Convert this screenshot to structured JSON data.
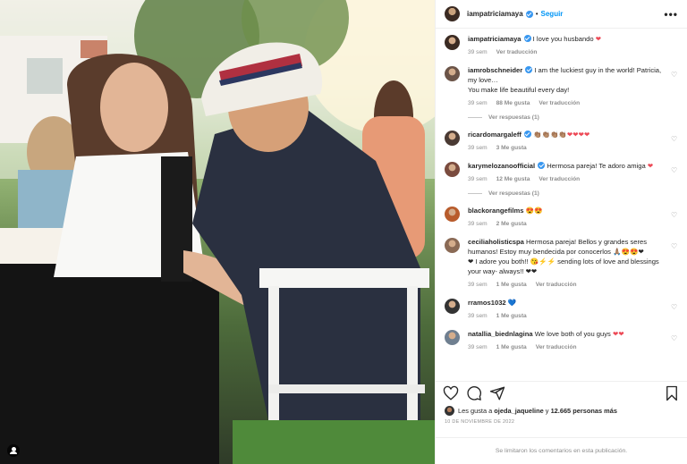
{
  "post": {
    "author": "iampatriciamaya",
    "follow_label": "Seguir",
    "more_label": "•••",
    "separator": "•"
  },
  "comments": [
    {
      "user": "iampatriciamaya",
      "verified": true,
      "text": "I love you husbando",
      "emoji": "❤",
      "time": "39 sem",
      "likes": "",
      "translate": "Ver traducción"
    },
    {
      "user": "iamrobschneider",
      "verified": true,
      "text": "I am the luckiest guy in the world! Patricia, my love…",
      "text2": "You make life beautiful every day!",
      "time": "39 sem",
      "likes": "88 Me gusta",
      "translate": "Ver traducción",
      "replies": "Ver respuestas (1)"
    },
    {
      "user": "ricardomargaleff",
      "verified": true,
      "text": "",
      "emoji": "👏🏽👏🏽👏🏽👏🏽❤❤❤❤",
      "time": "39 sem",
      "likes": "3 Me gusta",
      "translate": ""
    },
    {
      "user": "karymelozanoofficial",
      "verified": true,
      "text": "Hermosa pareja! Te adoro amiga",
      "emoji": "❤",
      "time": "39 sem",
      "likes": "12 Me gusta",
      "translate": "Ver traducción",
      "replies": "Ver respuestas (1)"
    },
    {
      "user": "blackorangefilms",
      "verified": false,
      "text": "",
      "emoji": "😍😍",
      "time": "39 sem",
      "likes": "2 Me gusta",
      "translate": ""
    },
    {
      "user": "ceciliaholisticspa",
      "verified": false,
      "text": "Hermosa pareja! Bellos y grandes seres humanos! Estoy muy bendecida por conocerlos 🙏🏽😍😍❤",
      "text2": "❤ I adore you both!! 😘⚡⚡ sending lots of love and blessings your way- always!! ❤❤",
      "time": "39 sem",
      "likes": "1 Me gusta",
      "translate": "Ver traducción"
    },
    {
      "user": "rramos1032",
      "verified": false,
      "text": "",
      "emoji": "💙",
      "time": "39 sem",
      "likes": "1 Me gusta",
      "translate": ""
    },
    {
      "user": "natallia_biednlagina",
      "verified": false,
      "text": "We love both of you guys",
      "emoji": "❤❤",
      "time": "39 sem",
      "likes": "1 Me gusta",
      "translate": "Ver traducción"
    }
  ],
  "likes_line": {
    "prefix": "Les gusta a",
    "user": "ojeda_jaqueline",
    "middle": "y",
    "count": "12.665 personas más"
  },
  "date": "10 DE NOVIEMBRE DE 2022",
  "footer": "Se limitaron los comentarios en esta publicación.",
  "icons": {
    "like": "heart-icon",
    "comment": "comment-icon",
    "share": "share-icon",
    "save": "bookmark-icon",
    "tag": "user-tag-icon"
  },
  "colors": {
    "link": "#0095f6",
    "verified": "#3897f0",
    "heart": "#ed4956",
    "muted": "#8e8e8e"
  }
}
